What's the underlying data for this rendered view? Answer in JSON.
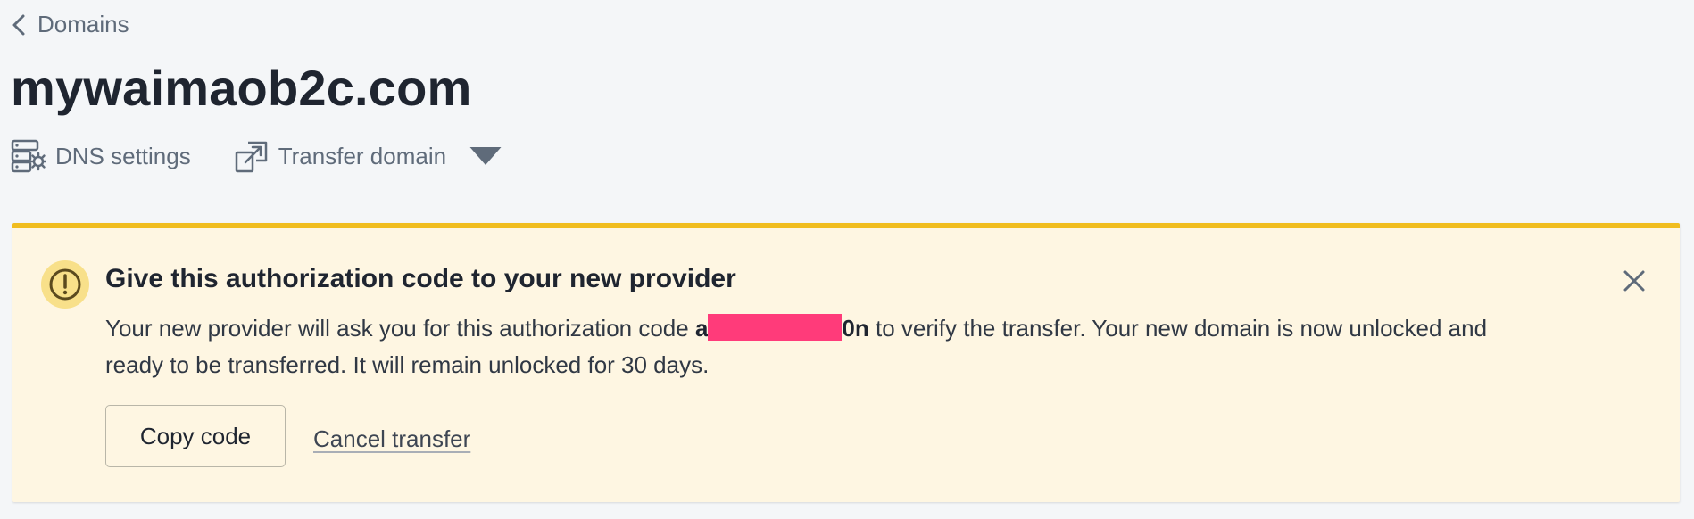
{
  "breadcrumb": {
    "back_label": "Domains"
  },
  "page_title": "mywaimaob2c.com",
  "actions": {
    "dns_settings_label": "DNS settings",
    "transfer_domain_label": "Transfer domain"
  },
  "alert": {
    "title": "Give this authorization code to your new provider",
    "body_prefix": "Your new provider will ask you for this authorization code ",
    "code_start": "a",
    "code_end": "0n",
    "body_suffix": " to verify the transfer. Your new domain is now unlocked and ready to be transferred. It will remain unlocked for 30 days.",
    "copy_button_label": "Copy code",
    "cancel_link_label": "Cancel transfer",
    "accent_color": "#f0bd1f",
    "background_color": "#fef6e2",
    "redaction_color": "#ff3b7a"
  },
  "icons": {
    "back": "chevron-left-icon",
    "dns": "server-gear-icon",
    "transfer": "external-transfer-icon",
    "dropdown": "caret-down-icon",
    "warning": "exclamation-circle-icon",
    "close": "close-icon"
  }
}
